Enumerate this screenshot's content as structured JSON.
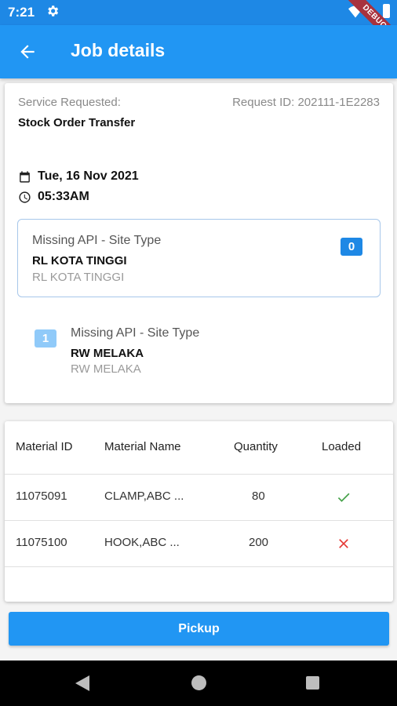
{
  "status_bar": {
    "time": "7:21",
    "debug_label": "DEBUG"
  },
  "app_bar": {
    "title": "Job details"
  },
  "job": {
    "service_label": "Service Requested:",
    "request_id": "Request ID: 202111-1E2283",
    "service_value": "Stock Order Transfer",
    "date": "Tue, 16 Nov 2021",
    "time": "05:33AM"
  },
  "stops": [
    {
      "type": "Missing API - Site Type",
      "name": "RL KOTA TINGGI",
      "sub": "RL KOTA TINGGI",
      "badge": "0",
      "badge_color": "#1e88e5"
    },
    {
      "type": "Missing API - Site Type",
      "name": "RW MELAKA",
      "sub": "RW MELAKA",
      "badge": "1",
      "badge_color": "#90caf9"
    }
  ],
  "table": {
    "headers": [
      "Material ID",
      "Material Name",
      "Quantity",
      "Loaded"
    ],
    "rows": [
      {
        "id": "11075091",
        "name": "CLAMP,ABC ...",
        "qty": "80",
        "loaded": "check-icon"
      },
      {
        "id": "11075100",
        "name": "HOOK,ABC ...",
        "qty": "200",
        "loaded": "cross-icon"
      }
    ]
  },
  "actions": {
    "pickup_label": "Pickup"
  },
  "colors": {
    "primary": "#2196f3",
    "status_bar": "#1e88e5",
    "loaded_yes": "#43a047",
    "loaded_no": "#e53935"
  }
}
